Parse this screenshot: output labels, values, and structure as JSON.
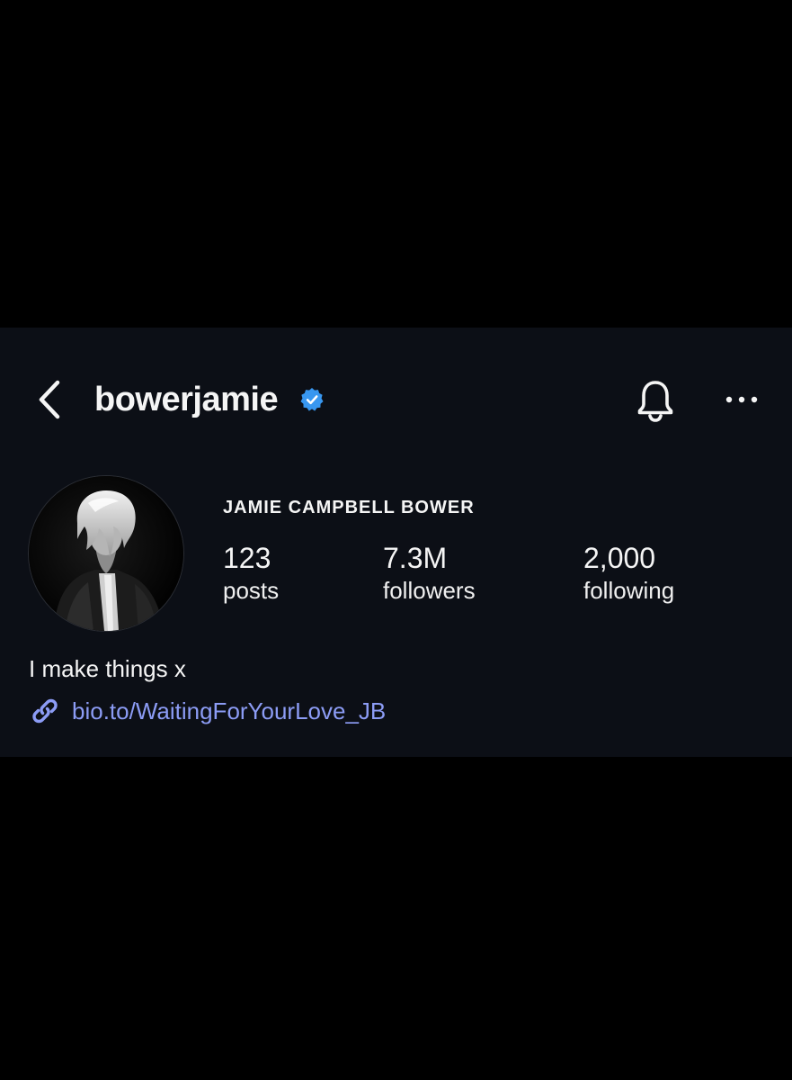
{
  "profile": {
    "username": "bowerjamie",
    "verified": true,
    "full_name": "JAMIE CAMPBELL BOWER",
    "bio": "I make things x",
    "link": "bio.to/WaitingForYourLove_JB"
  },
  "stats": [
    {
      "value": "123",
      "label": "posts"
    },
    {
      "value": "7.3M",
      "label": "followers"
    },
    {
      "value": "2,000",
      "label": "following"
    }
  ],
  "icons": {
    "back": "chevron-left-icon",
    "verified": "verified-badge-icon",
    "notifications": "bell-icon",
    "more": "more-horizontal-icon",
    "link": "link-icon"
  },
  "colors": {
    "background": "#000000",
    "panel": "#0c0f16",
    "text": "#f5f5f5",
    "link": "#8c9cf5",
    "verified": "#3897f0"
  }
}
